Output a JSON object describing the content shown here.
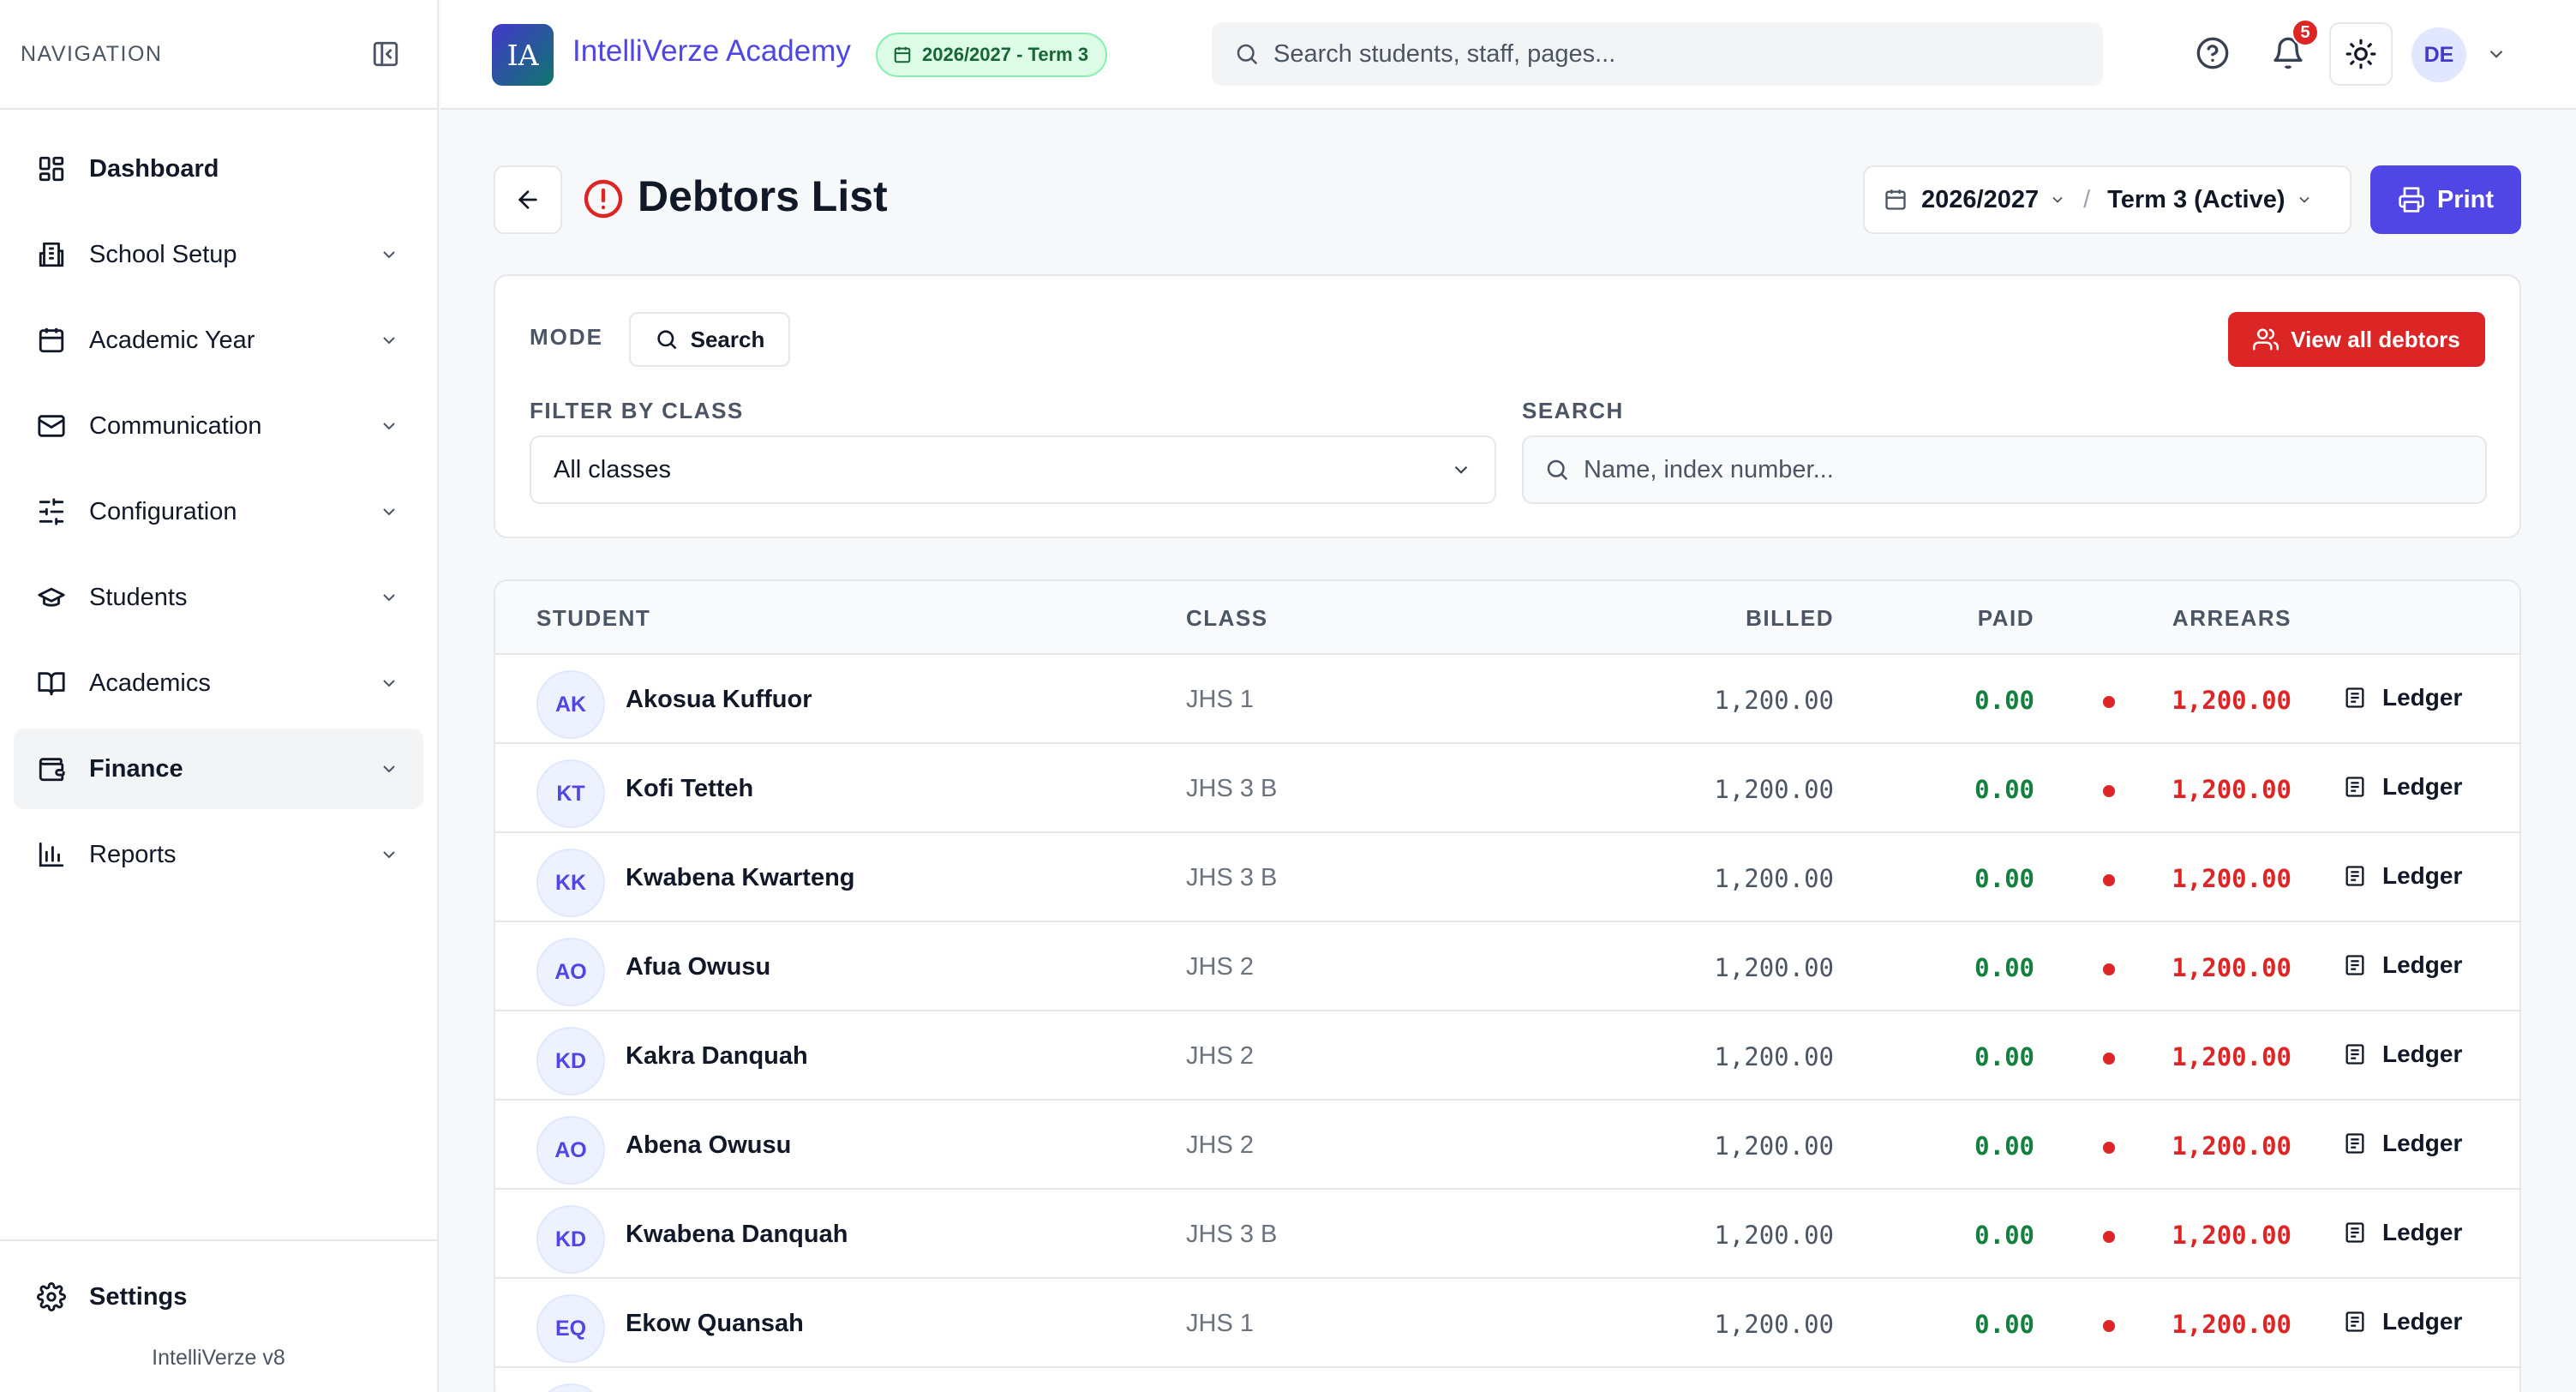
{
  "sidebar": {
    "heading": "NAVIGATION",
    "items": [
      {
        "label": "Dashboard",
        "icon": "grid-icon"
      },
      {
        "label": "School Setup",
        "icon": "building-icon"
      },
      {
        "label": "Academic Year",
        "icon": "calendar-icon"
      },
      {
        "label": "Communication",
        "icon": "mail-icon"
      },
      {
        "label": "Configuration",
        "icon": "sliders-icon"
      },
      {
        "label": "Students",
        "icon": "graduation-cap-icon"
      },
      {
        "label": "Academics",
        "icon": "book-icon"
      },
      {
        "label": "Finance",
        "icon": "wallet-icon"
      },
      {
        "label": "Reports",
        "icon": "bar-chart-icon"
      }
    ],
    "settings_label": "Settings",
    "version": "IntelliVerze v8"
  },
  "topbar": {
    "logo_text": "IA",
    "app_name": "IntelliVerze Academy",
    "term_badge": "2026/2027 - Term 3",
    "search_placeholder": "Search students, staff, pages...",
    "notification_count": "5",
    "user_initials": "DE"
  },
  "page": {
    "title": "Debtors List",
    "year": "2026/2027",
    "term": "Term 3 (Active)",
    "print_label": "Print"
  },
  "filters": {
    "mode_label": "MODE",
    "mode_value": "Search",
    "view_all_label": "View all debtors",
    "class_label": "FILTER BY CLASS",
    "class_value": "All classes",
    "search_label": "SEARCH",
    "search_placeholder": "Name, index number..."
  },
  "table": {
    "headers": {
      "student": "STUDENT",
      "class": "CLASS",
      "billed": "BILLED",
      "paid": "PAID",
      "arrears": "ARREARS"
    },
    "ledger_label": "Ledger",
    "rows": [
      {
        "initials": "AK",
        "name": "Akosua Kuffuor",
        "class": "JHS 1",
        "billed": "1,200.00",
        "paid": "0.00",
        "arrears": "1,200.00"
      },
      {
        "initials": "KT",
        "name": "Kofi Tetteh",
        "class": "JHS 3 B",
        "billed": "1,200.00",
        "paid": "0.00",
        "arrears": "1,200.00"
      },
      {
        "initials": "KK",
        "name": "Kwabena Kwarteng",
        "class": "JHS 3 B",
        "billed": "1,200.00",
        "paid": "0.00",
        "arrears": "1,200.00"
      },
      {
        "initials": "AO",
        "name": "Afua Owusu",
        "class": "JHS 2",
        "billed": "1,200.00",
        "paid": "0.00",
        "arrears": "1,200.00"
      },
      {
        "initials": "KD",
        "name": "Kakra Danquah",
        "class": "JHS 2",
        "billed": "1,200.00",
        "paid": "0.00",
        "arrears": "1,200.00"
      },
      {
        "initials": "AO",
        "name": "Abena Owusu",
        "class": "JHS 2",
        "billed": "1,200.00",
        "paid": "0.00",
        "arrears": "1,200.00"
      },
      {
        "initials": "KD",
        "name": "Kwabena Danquah",
        "class": "JHS 3 B",
        "billed": "1,200.00",
        "paid": "0.00",
        "arrears": "1,200.00"
      },
      {
        "initials": "EQ",
        "name": "Ekow Quansah",
        "class": "JHS 1",
        "billed": "1,200.00",
        "paid": "0.00",
        "arrears": "1,200.00"
      }
    ]
  },
  "colors": {
    "accent": "#4f46e5",
    "danger": "#dc2626",
    "success": "#15803d"
  }
}
